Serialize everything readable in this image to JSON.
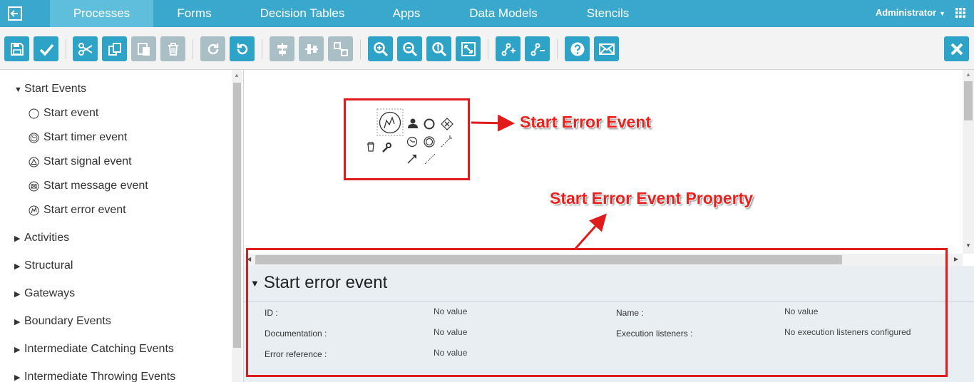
{
  "nav": {
    "tabs": [
      {
        "label": "Processes",
        "active": true
      },
      {
        "label": "Forms"
      },
      {
        "label": "Decision Tables"
      },
      {
        "label": "Apps"
      },
      {
        "label": "Data Models"
      },
      {
        "label": "Stencils"
      }
    ],
    "user": "Administrator"
  },
  "toolbar": {
    "buttons": [
      "save",
      "validate",
      "cut",
      "copy",
      "paste",
      "delete",
      "redo",
      "undo",
      "align-horizontal",
      "align-vertical",
      "same-size",
      "zoom-in",
      "zoom-out",
      "zoom-actual",
      "zoom-fit",
      "add-bendpoint",
      "remove-bendpoint",
      "help",
      "feedback",
      "close"
    ]
  },
  "palette": {
    "groups": [
      {
        "label": "Start Events",
        "expanded": true,
        "items": [
          {
            "label": "Start event",
            "icon": "circle-icon"
          },
          {
            "label": "Start timer event",
            "icon": "timer-icon"
          },
          {
            "label": "Start signal event",
            "icon": "signal-icon"
          },
          {
            "label": "Start message event",
            "icon": "message-icon"
          },
          {
            "label": "Start error event",
            "icon": "error-icon"
          }
        ]
      },
      {
        "label": "Activities"
      },
      {
        "label": "Structural"
      },
      {
        "label": "Gateways"
      },
      {
        "label": "Boundary Events"
      },
      {
        "label": "Intermediate Catching Events"
      },
      {
        "label": "Intermediate Throwing Events"
      }
    ]
  },
  "annotations": {
    "event_label": "Start Error Event",
    "property_label": "Start Error Event Property"
  },
  "properties": {
    "title": "Start error event",
    "left": [
      {
        "label": "ID :",
        "value": "No value"
      },
      {
        "label": "Documentation :",
        "value": "No value"
      },
      {
        "label": "Error reference :",
        "value": "No value"
      }
    ],
    "right": [
      {
        "label": "Name :",
        "value": "No value"
      },
      {
        "label": "Execution listeners :",
        "value": "No execution listeners configured"
      }
    ]
  },
  "colors": {
    "nav_bg": "#3aa8cc",
    "button_bg": "#2ea3c8",
    "annotation_red": "#e01b1b"
  }
}
